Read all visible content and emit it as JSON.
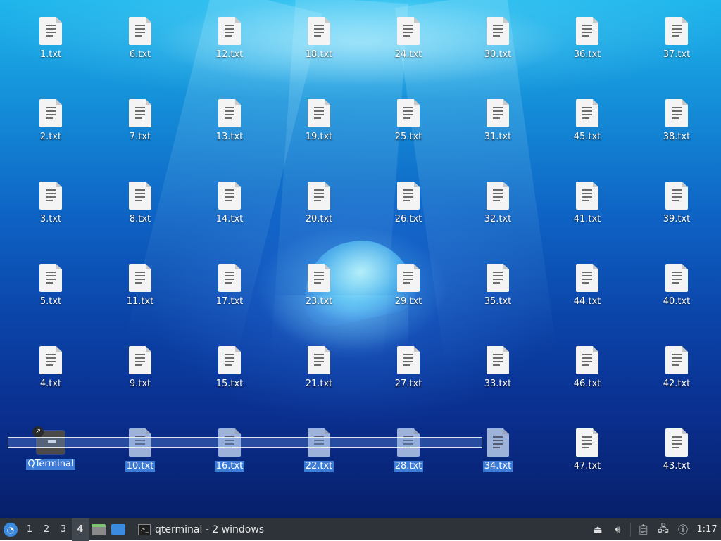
{
  "desktop": {
    "icons": [
      {
        "label": "1.txt",
        "col": 0,
        "row": 0
      },
      {
        "label": "6.txt",
        "col": 1,
        "row": 0
      },
      {
        "label": "12.txt",
        "col": 2,
        "row": 0
      },
      {
        "label": "18.txt",
        "col": 3,
        "row": 0
      },
      {
        "label": "24.txt",
        "col": 4,
        "row": 0
      },
      {
        "label": "30.txt",
        "col": 5,
        "row": 0
      },
      {
        "label": "36.txt",
        "col": 6,
        "row": 0
      },
      {
        "label": "37.txt",
        "col": 7,
        "row": 0
      },
      {
        "label": "2.txt",
        "col": 0,
        "row": 1
      },
      {
        "label": "7.txt",
        "col": 1,
        "row": 1
      },
      {
        "label": "13.txt",
        "col": 2,
        "row": 1
      },
      {
        "label": "19.txt",
        "col": 3,
        "row": 1
      },
      {
        "label": "25.txt",
        "col": 4,
        "row": 1
      },
      {
        "label": "31.txt",
        "col": 5,
        "row": 1
      },
      {
        "label": "45.txt",
        "col": 6,
        "row": 1
      },
      {
        "label": "38.txt",
        "col": 7,
        "row": 1
      },
      {
        "label": "3.txt",
        "col": 0,
        "row": 2
      },
      {
        "label": "8.txt",
        "col": 1,
        "row": 2
      },
      {
        "label": "14.txt",
        "col": 2,
        "row": 2
      },
      {
        "label": "20.txt",
        "col": 3,
        "row": 2
      },
      {
        "label": "26.txt",
        "col": 4,
        "row": 2
      },
      {
        "label": "32.txt",
        "col": 5,
        "row": 2
      },
      {
        "label": "41.txt",
        "col": 6,
        "row": 2
      },
      {
        "label": "39.txt",
        "col": 7,
        "row": 2
      },
      {
        "label": "5.txt",
        "col": 0,
        "row": 3
      },
      {
        "label": "11.txt",
        "col": 1,
        "row": 3
      },
      {
        "label": "17.txt",
        "col": 2,
        "row": 3
      },
      {
        "label": "23.txt",
        "col": 3,
        "row": 3
      },
      {
        "label": "29.txt",
        "col": 4,
        "row": 3
      },
      {
        "label": "35.txt",
        "col": 5,
        "row": 3
      },
      {
        "label": "44.txt",
        "col": 6,
        "row": 3
      },
      {
        "label": "40.txt",
        "col": 7,
        "row": 3
      },
      {
        "label": "4.txt",
        "col": 0,
        "row": 4
      },
      {
        "label": "9.txt",
        "col": 1,
        "row": 4
      },
      {
        "label": "15.txt",
        "col": 2,
        "row": 4
      },
      {
        "label": "21.txt",
        "col": 3,
        "row": 4
      },
      {
        "label": "27.txt",
        "col": 4,
        "row": 4
      },
      {
        "label": "33.txt",
        "col": 5,
        "row": 4
      },
      {
        "label": "46.txt",
        "col": 6,
        "row": 4
      },
      {
        "label": "42.txt",
        "col": 7,
        "row": 4
      },
      {
        "label": "QTerminal",
        "col": 0,
        "row": 5,
        "kind": "terminal",
        "selected": true
      },
      {
        "label": "10.txt",
        "col": 1,
        "row": 5,
        "selected": true
      },
      {
        "label": "16.txt",
        "col": 2,
        "row": 5,
        "selected": true
      },
      {
        "label": "22.txt",
        "col": 3,
        "row": 5,
        "selected": true
      },
      {
        "label": "28.txt",
        "col": 4,
        "row": 5,
        "selected": true
      },
      {
        "label": "34.txt",
        "col": 5,
        "row": 5,
        "selected": true
      },
      {
        "label": "47.txt",
        "col": 6,
        "row": 5
      },
      {
        "label": "43.txt",
        "col": 7,
        "row": 5
      }
    ]
  },
  "taskbar": {
    "workspaces": [
      {
        "label": "1",
        "active": false
      },
      {
        "label": "2",
        "active": false
      },
      {
        "label": "3",
        "active": false
      },
      {
        "label": "4",
        "active": true
      }
    ],
    "task_label": "qterminal - 2 windows",
    "clock": "1:17",
    "tray_icons": [
      "eject-icon",
      "volume-icon",
      "clipboard-icon",
      "network-icon",
      "update-notifier-icon"
    ]
  },
  "colors": {
    "taskbar_bg": "#2d3339",
    "selection": "#3d7cd6"
  }
}
